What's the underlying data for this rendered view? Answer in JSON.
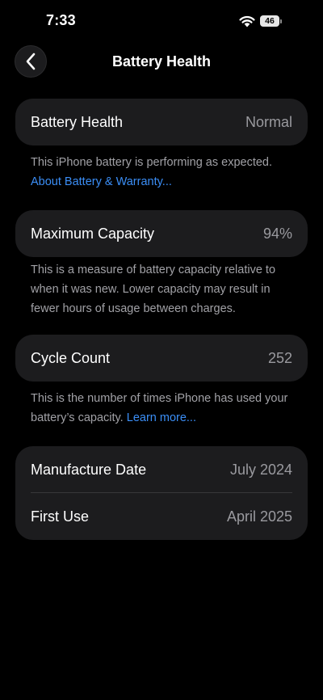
{
  "status_bar": {
    "time": "7:33",
    "battery_level": "46"
  },
  "nav": {
    "title": "Battery Health"
  },
  "battery_health": {
    "label": "Battery Health",
    "value": "Normal",
    "note": "This iPhone battery is performing as expected.",
    "link": "About Battery & Warranty..."
  },
  "max_capacity": {
    "label": "Maximum Capacity",
    "value": "94%",
    "note": "This is a measure of battery capacity relative to when it was new. Lower capacity may result in fewer hours of usage between charges."
  },
  "cycle_count": {
    "label": "Cycle Count",
    "value": "252",
    "note": "This is the number of times iPhone has used your battery’s capacity.",
    "link": "Learn more..."
  },
  "dates": {
    "manufacture_label": "Manufacture Date",
    "manufacture_value": "July 2024",
    "first_use_label": "First Use",
    "first_use_value": "April 2025"
  },
  "colors": {
    "background": "#000000",
    "card": "#1c1c1e",
    "secondary_text": "#a1a1a6",
    "link": "#3b8ef6"
  }
}
